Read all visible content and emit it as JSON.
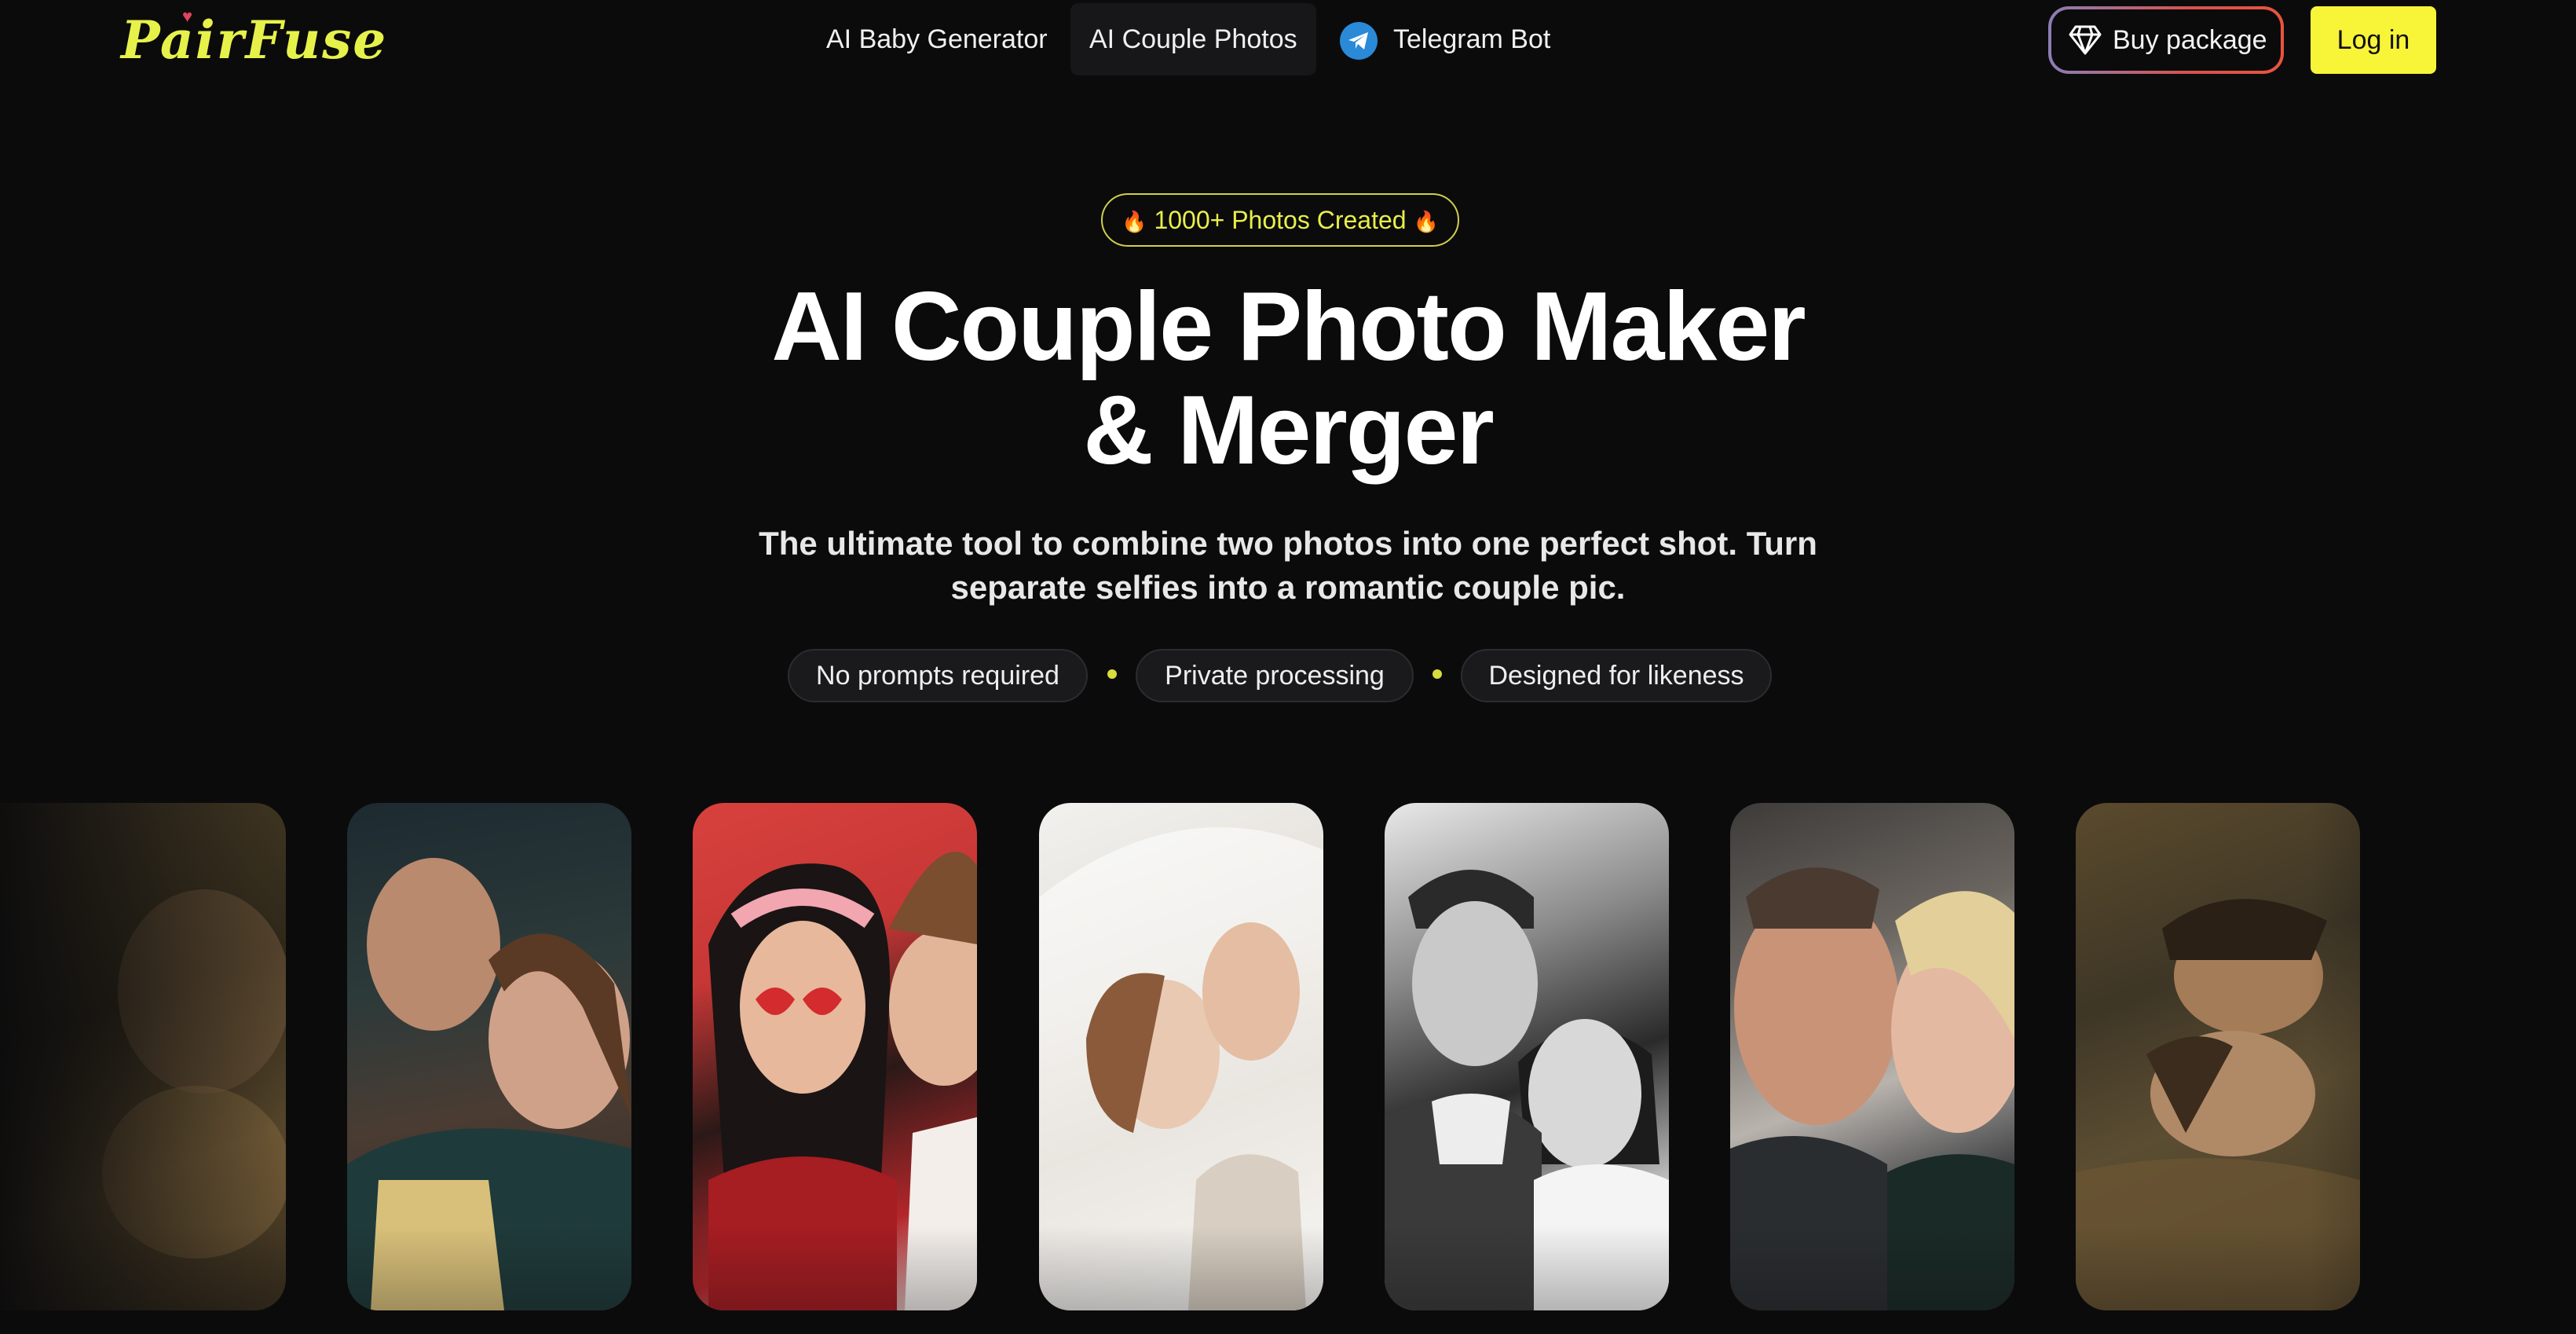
{
  "brand": {
    "name": "PairFuse",
    "accent": "#f8f437",
    "background": "#0b0b0c"
  },
  "nav": {
    "links": [
      {
        "label": "AI Baby Generator",
        "active": false
      },
      {
        "label": "AI Couple Photos",
        "active": true
      },
      {
        "label": "Telegram Bot",
        "active": false,
        "icon": "telegram-icon"
      }
    ],
    "buy_label": "Buy package",
    "buy_icon": "diamond-icon",
    "login_label": "Log in"
  },
  "hero": {
    "badge": "1000+ Photos Created",
    "badge_icon": "fire-icon",
    "title_line1": "AI Couple Photo Maker",
    "title_line2": "& Merger",
    "subtitle_line1": "The ultimate tool to combine two photos into one perfect shot. Turn",
    "subtitle_line2": "separate selfies into a romantic couple pic.",
    "features": [
      "No prompts required",
      "Private processing",
      "Designed for likeness"
    ]
  },
  "gallery": {
    "items": [
      {
        "name": "couple-photo-straw-partial"
      },
      {
        "name": "couple-photo-restaurant"
      },
      {
        "name": "couple-photo-heart-glasses"
      },
      {
        "name": "couple-photo-wedding-veil"
      },
      {
        "name": "couple-photo-black-white"
      },
      {
        "name": "couple-photo-winter"
      },
      {
        "name": "couple-photo-straw"
      }
    ]
  }
}
